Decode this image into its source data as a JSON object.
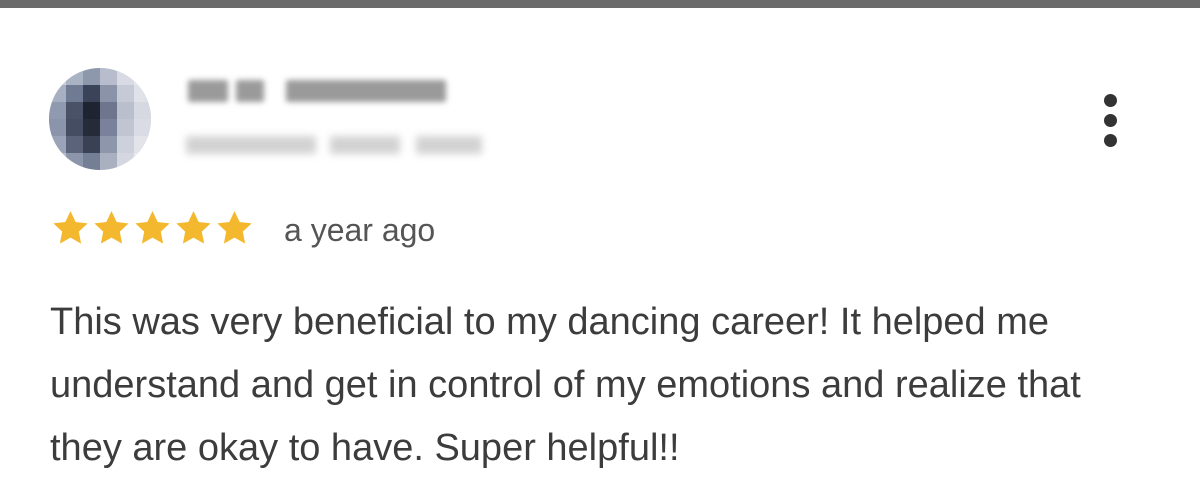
{
  "review": {
    "time_ago": "a year ago",
    "rating": 5,
    "rating_max": 5,
    "text": "This was very beneficial to my dancing career! It helped me understand and get in control of my emotions and realize that they are okay to have. Super helpful!!",
    "star_color": "#F4B82E",
    "more_icon": "more-vert-icon",
    "star_icon": "star-icon",
    "avatar_state": "pixelated",
    "author_state": "blurred"
  },
  "theme": {
    "top_bar_color": "#6b6b6b",
    "text_color": "#3c3c3c",
    "muted_text_color": "#555555"
  }
}
